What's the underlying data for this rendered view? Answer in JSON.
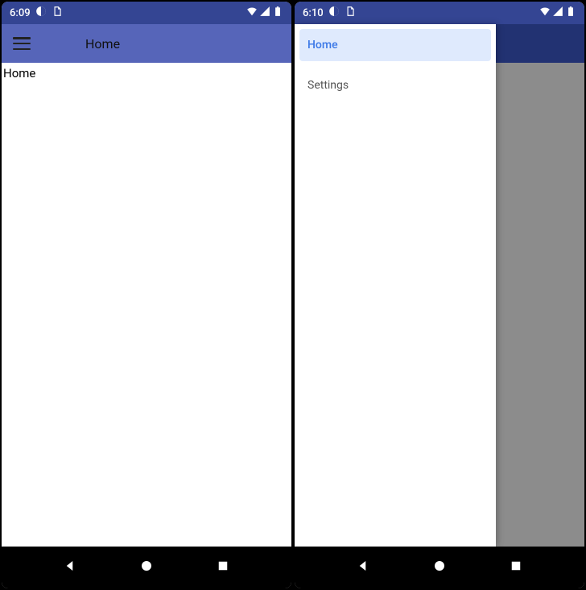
{
  "left": {
    "status_time": "6:09",
    "appbar_title": "Home",
    "content_text": "Home"
  },
  "right": {
    "status_time": "6:10",
    "drawer": {
      "items": [
        {
          "label": "Home",
          "selected": true
        },
        {
          "label": "Settings",
          "selected": false
        }
      ]
    }
  },
  "icons": {
    "flutter": "◐",
    "debug": "▣"
  }
}
